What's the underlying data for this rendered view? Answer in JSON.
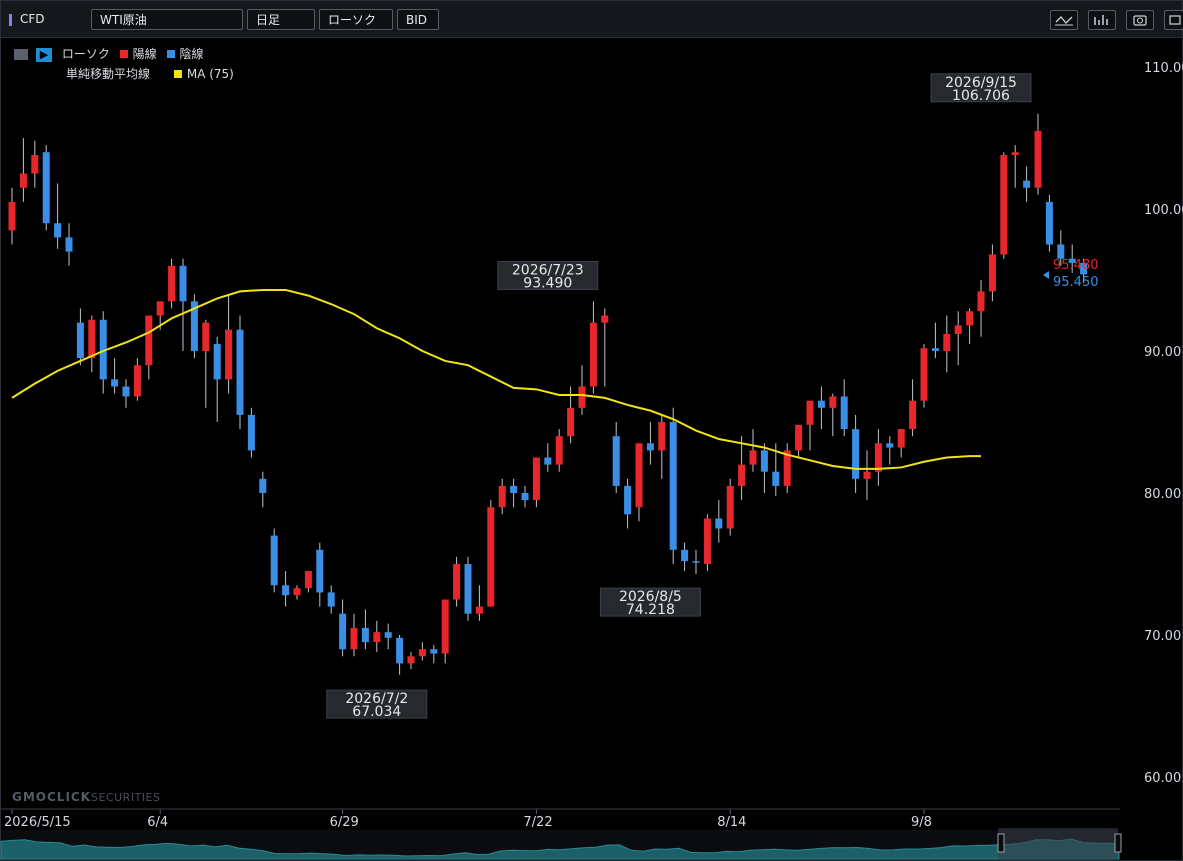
{
  "toolbar": {
    "market": "CFD",
    "symbol": "WTI原油",
    "period": "日足",
    "chart_style": "ローソク",
    "price_side": "BID"
  },
  "legend": {
    "candle_label": "ローソク",
    "up_label": "陽線",
    "down_label": "陰線",
    "ma_label": "単純移動平均線",
    "ma_item": "MA (75)",
    "up_color": "#e8272c",
    "down_color": "#3a8ee6",
    "ma_color": "#f2e313"
  },
  "watermark": {
    "brand": "GMOCLICK",
    "suffix": "SECURITIES"
  },
  "price_tags": {
    "bid": "95.480",
    "ask": "95.450"
  },
  "chart_data": {
    "type": "candlestick",
    "title": "",
    "xlabel": "",
    "ylabel": "",
    "ylim": [
      57.5,
      112.0
    ],
    "yticks": [
      "110.00",
      "100.00",
      "90.00",
      "80.00",
      "70.00",
      "60.00"
    ],
    "yticks_values": [
      110,
      100,
      90,
      80,
      70,
      60
    ],
    "xtick_labels": [
      {
        "label": "2026/5/15",
        "index": 0
      },
      {
        "label": "6/4",
        "index": 13
      },
      {
        "label": "6/29",
        "index": 29
      },
      {
        "label": "7/22",
        "index": 46
      },
      {
        "label": "8/14",
        "index": 63
      },
      {
        "label": "9/8",
        "index": 80
      }
    ],
    "annotations": [
      {
        "date": "2026/9/15",
        "value": "106.706",
        "index": 85
      },
      {
        "date": "2026/7/23",
        "value": "93.490",
        "index": 47
      },
      {
        "date": "2026/8/5",
        "value": "74.218",
        "index": 56
      },
      {
        "date": "2026/7/2",
        "value": "67.034",
        "index": 32
      }
    ],
    "candles": [
      [
        98.5,
        101.5,
        100.5,
        97.5
      ],
      [
        101.5,
        105,
        102.5,
        100.5
      ],
      [
        102.5,
        104.8,
        103.8,
        101.5
      ],
      [
        104,
        104.5,
        99,
        98.5
      ],
      [
        99,
        101.8,
        98,
        97.2
      ],
      [
        98,
        99,
        97,
        96
      ],
      [
        92,
        93,
        89.5,
        89
      ],
      [
        89.5,
        92.5,
        92.2,
        88.5
      ],
      [
        92.2,
        92.8,
        88,
        87
      ],
      [
        88,
        89.5,
        87.5,
        87
      ],
      [
        87.5,
        88,
        86.8,
        86
      ],
      [
        86.8,
        89.5,
        89,
        86.5
      ],
      [
        89,
        91.5,
        92.5,
        88
      ],
      [
        92.5,
        92.5,
        93.5,
        91.5
      ],
      [
        93.5,
        96.5,
        96,
        93
      ],
      [
        96,
        96.5,
        93.5,
        90
      ],
      [
        93.5,
        94,
        90,
        89.5
      ],
      [
        90,
        92.2,
        92,
        86
      ],
      [
        90.5,
        91,
        88,
        85
      ],
      [
        88,
        94,
        91.5,
        87
      ],
      [
        91.5,
        92.5,
        85.5,
        84.5
      ],
      [
        85.5,
        86,
        83,
        82.5
      ],
      [
        81,
        81.5,
        80,
        79
      ],
      [
        77,
        77.5,
        73.5,
        73
      ],
      [
        73.5,
        74.5,
        72.8,
        72
      ],
      [
        72.8,
        73.5,
        73.3,
        72.5
      ],
      [
        73.3,
        74.5,
        74.5,
        73
      ],
      [
        76,
        76.5,
        73,
        72
      ],
      [
        73,
        73.5,
        72,
        71.5
      ],
      [
        71.5,
        72.5,
        69,
        68.5
      ],
      [
        69,
        71.5,
        70.5,
        68.5
      ],
      [
        70.5,
        71.8,
        69.5,
        69
      ],
      [
        69.5,
        71,
        70.2,
        68.8
      ],
      [
        70.2,
        70.8,
        69.8,
        69
      ],
      [
        69.8,
        70,
        68,
        67.2
      ],
      [
        68,
        68.8,
        68.5,
        67.6
      ],
      [
        68.5,
        69.5,
        69,
        68.2
      ],
      [
        69,
        69.3,
        68.7,
        68
      ],
      [
        68.7,
        72,
        72.5,
        68
      ],
      [
        72.5,
        75.5,
        75,
        72
      ],
      [
        75,
        75.5,
        71.5,
        71
      ],
      [
        71.5,
        73.5,
        72,
        71
      ],
      [
        72,
        79.5,
        79,
        72
      ],
      [
        79,
        81,
        80.5,
        78.5
      ],
      [
        80.5,
        81,
        80,
        79
      ],
      [
        80,
        80.5,
        79.5,
        79
      ],
      [
        79.5,
        82.5,
        82.5,
        79
      ],
      [
        82.5,
        83.5,
        82,
        81.5
      ],
      [
        82,
        84.5,
        84,
        81.5
      ],
      [
        84,
        87.5,
        86,
        83.5
      ],
      [
        86,
        89,
        87.5,
        85.5
      ],
      [
        87.5,
        93.5,
        92,
        87
      ],
      [
        92,
        93,
        92.5,
        87.5
      ],
      [
        84,
        85,
        80.5,
        80
      ],
      [
        80.5,
        81,
        78.5,
        77.5
      ],
      [
        79,
        81.5,
        83.5,
        78
      ],
      [
        83.5,
        85,
        83,
        82
      ],
      [
        83,
        85.5,
        85,
        81
      ],
      [
        85,
        86,
        76,
        75
      ],
      [
        76,
        76.5,
        75.2,
        74.5
      ],
      [
        75.2,
        76,
        75.1,
        74.3
      ],
      [
        75,
        78.5,
        78.2,
        74.5
      ],
      [
        78.2,
        79.5,
        77.5,
        76.5
      ],
      [
        77.5,
        81,
        80.5,
        77
      ],
      [
        80.5,
        84,
        82,
        79.5
      ],
      [
        82,
        84.5,
        83,
        81.5
      ],
      [
        83,
        83.5,
        81.5,
        80
      ],
      [
        81.5,
        83.5,
        80.5,
        79.8
      ],
      [
        80.5,
        83.5,
        83,
        80
      ],
      [
        83,
        84,
        84.8,
        82.5
      ],
      [
        84.8,
        86.5,
        86.5,
        83
      ],
      [
        86.5,
        87.5,
        86,
        84.5
      ],
      [
        86,
        87,
        86.8,
        84
      ],
      [
        86.8,
        88,
        84.5,
        84
      ],
      [
        84.5,
        85.5,
        81,
        80
      ],
      [
        81,
        83,
        81.5,
        79.5
      ],
      [
        81.5,
        84.5,
        83.5,
        80.5
      ],
      [
        83.5,
        84,
        83.2,
        82
      ],
      [
        83.2,
        84,
        84.5,
        82.5
      ],
      [
        84.5,
        88,
        86.5,
        84
      ],
      [
        86.5,
        90.5,
        90.2,
        86
      ],
      [
        90.2,
        92,
        90,
        89.5
      ],
      [
        90,
        92.5,
        91.2,
        88.5
      ],
      [
        91.2,
        92.8,
        91.8,
        89
      ],
      [
        91.8,
        93,
        92.8,
        90.5
      ],
      [
        92.8,
        95,
        94.2,
        91
      ],
      [
        94.2,
        97.5,
        96.8,
        93.5
      ],
      [
        96.8,
        104,
        103.8,
        96.5
      ],
      [
        103.8,
        104.5,
        104,
        101.5
      ],
      [
        102,
        103,
        101.5,
        100.5
      ],
      [
        101.5,
        106.7,
        105.5,
        101
      ],
      [
        100.5,
        101,
        97.5,
        97
      ],
      [
        97.5,
        98.5,
        96.5,
        96
      ],
      [
        96.5,
        97.5,
        96.2,
        95.5
      ],
      [
        96.2,
        96.5,
        95.4,
        94.8
      ]
    ],
    "ma75": [
      [
        0,
        86.7
      ],
      [
        2,
        87.7
      ],
      [
        4,
        88.6
      ],
      [
        6,
        89.3
      ],
      [
        8,
        90.0
      ],
      [
        10,
        90.6
      ],
      [
        12,
        91.3
      ],
      [
        14,
        92.3
      ],
      [
        16,
        93.0
      ],
      [
        18,
        93.7
      ],
      [
        20,
        94.2
      ],
      [
        22,
        94.3
      ],
      [
        24,
        94.3
      ],
      [
        26,
        93.9
      ],
      [
        28,
        93.3
      ],
      [
        30,
        92.6
      ],
      [
        32,
        91.6
      ],
      [
        34,
        90.9
      ],
      [
        36,
        90.0
      ],
      [
        38,
        89.3
      ],
      [
        40,
        89.0
      ],
      [
        42,
        88.2
      ],
      [
        44,
        87.4
      ],
      [
        46,
        87.3
      ],
      [
        48,
        86.9
      ],
      [
        50,
        86.9
      ],
      [
        52,
        86.7
      ],
      [
        54,
        86.2
      ],
      [
        56,
        85.8
      ],
      [
        58,
        85.2
      ],
      [
        60,
        84.4
      ],
      [
        62,
        83.8
      ],
      [
        64,
        83.5
      ],
      [
        66,
        83.2
      ],
      [
        68,
        82.7
      ],
      [
        70,
        82.3
      ],
      [
        72,
        81.9
      ],
      [
        74,
        81.7
      ],
      [
        76,
        81.7
      ],
      [
        78,
        81.8
      ],
      [
        80,
        82.2
      ],
      [
        82,
        82.5
      ],
      [
        84,
        82.6
      ],
      [
        85,
        82.6
      ]
    ]
  }
}
